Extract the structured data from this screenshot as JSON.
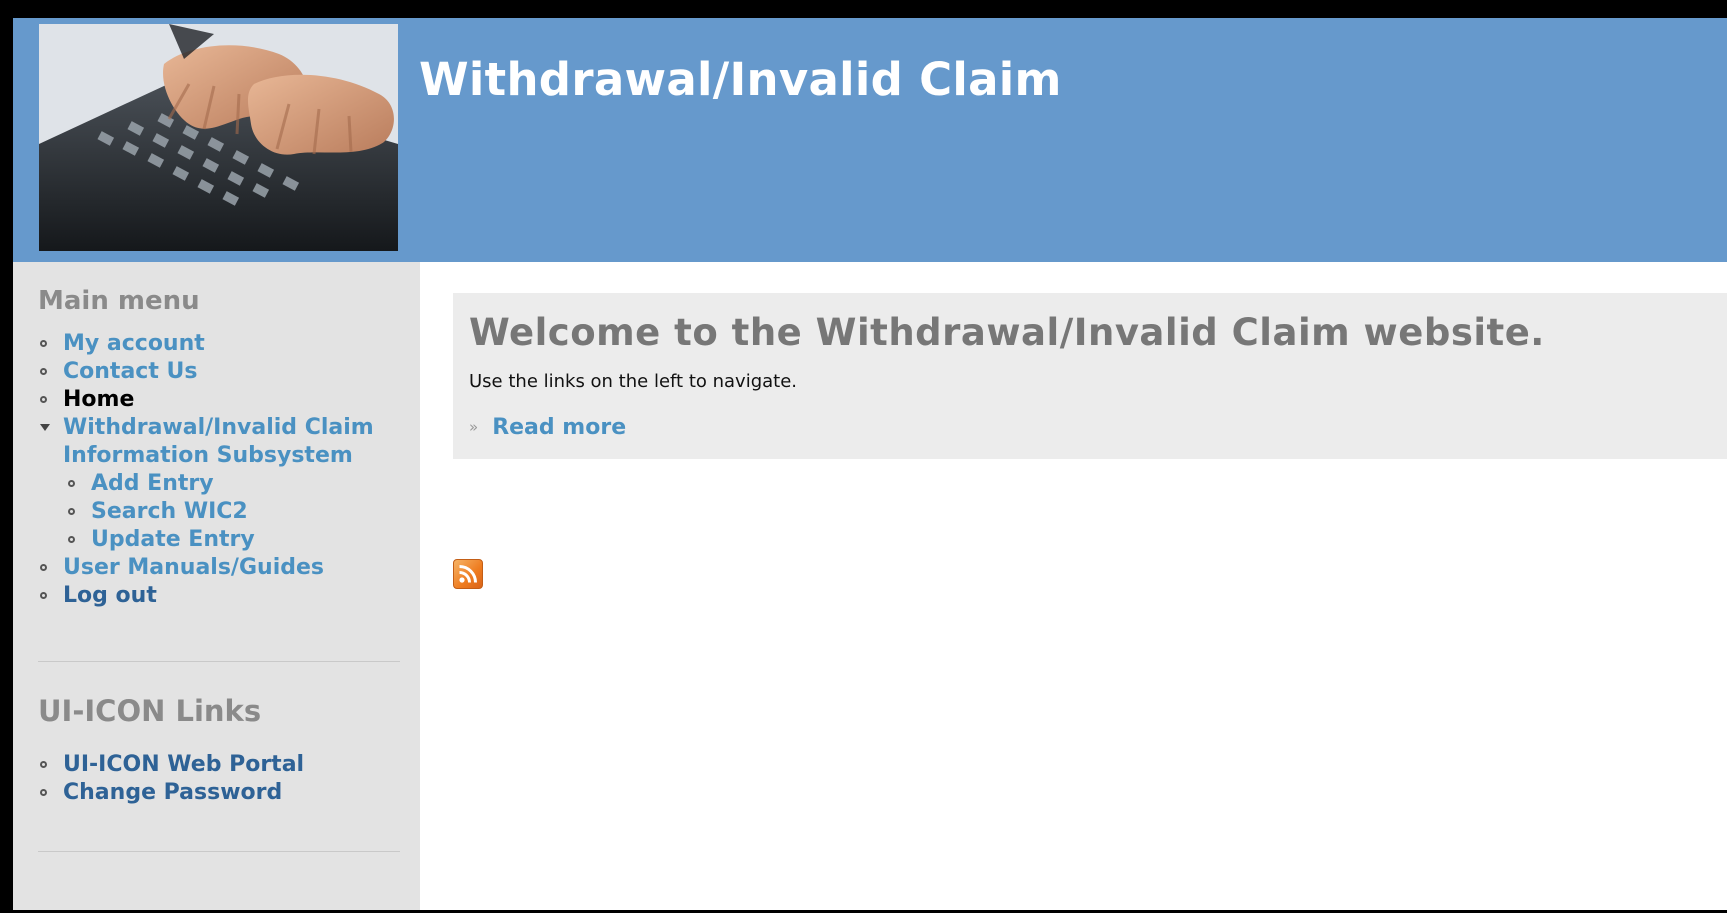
{
  "header": {
    "title": "Withdrawal/Invalid Claim",
    "photo_icon": "keyboard-typing-photo"
  },
  "sidebar": {
    "main_menu": {
      "title": "Main menu",
      "items": [
        {
          "label": "My account",
          "state": "link"
        },
        {
          "label": "Contact Us",
          "state": "link"
        },
        {
          "label": "Home",
          "state": "active"
        },
        {
          "label": "Withdrawal/Invalid Claim",
          "label_line2": "Information Subsystem",
          "state": "link",
          "expanded": true,
          "children": [
            {
              "label": "Add Entry"
            },
            {
              "label": "Search WIC2"
            },
            {
              "label": "Update Entry"
            }
          ]
        },
        {
          "label": "User Manuals/Guides",
          "state": "link"
        },
        {
          "label": "Log out",
          "state": "link-dark"
        }
      ]
    },
    "uiicon_links": {
      "title": "UI-ICON Links",
      "items": [
        {
          "label": "UI-ICON Web Portal"
        },
        {
          "label": "Change Password"
        }
      ]
    }
  },
  "main": {
    "welcome_heading": "Welcome to the Withdrawal/Invalid Claim website.",
    "welcome_text": "Use the links on the left to navigate.",
    "read_more_label": "Read more",
    "read_more_marker": "»",
    "feed_icon": "rss-feed-icon"
  },
  "colors": {
    "header_bg": "#6699cc",
    "sidebar_bg": "#e3e3e3",
    "link": "#4a91c2",
    "link_dark": "#2e6296",
    "content_box_bg": "#ececec",
    "heading_gray": "#777777"
  }
}
